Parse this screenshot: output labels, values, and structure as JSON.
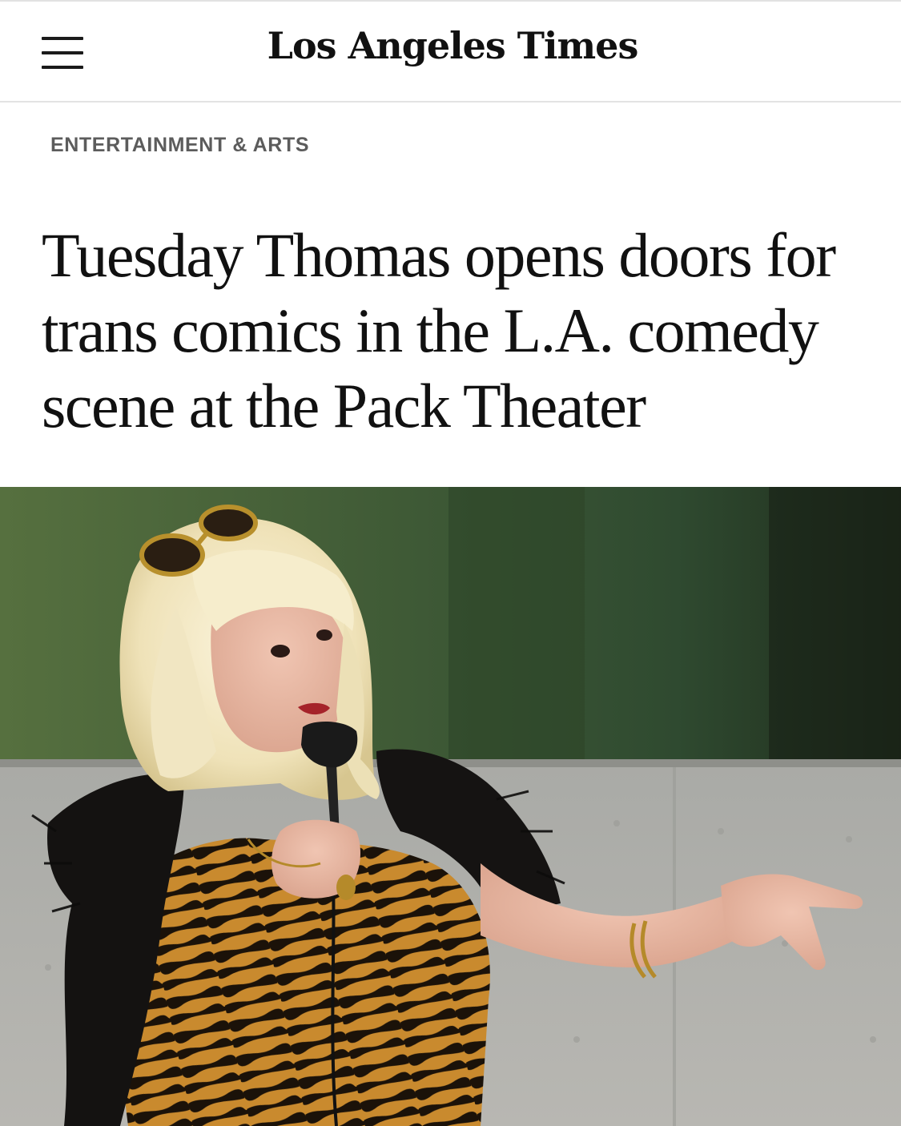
{
  "header": {
    "menu_icon": "hamburger-menu-icon",
    "logo_text": "Los Angeles Times"
  },
  "article": {
    "section": "ENTERTAINMENT & ARTS",
    "headline": "Tuesday Thomas opens doors for trans comics in the L.A. comedy scene at the Pack Theater",
    "hero_image": {
      "subject": "performer with microphone"
    }
  },
  "colors": {
    "background": "#ffffff",
    "text": "#111111",
    "section_label": "#5c5c5c",
    "divider": "#e3e3e3"
  }
}
